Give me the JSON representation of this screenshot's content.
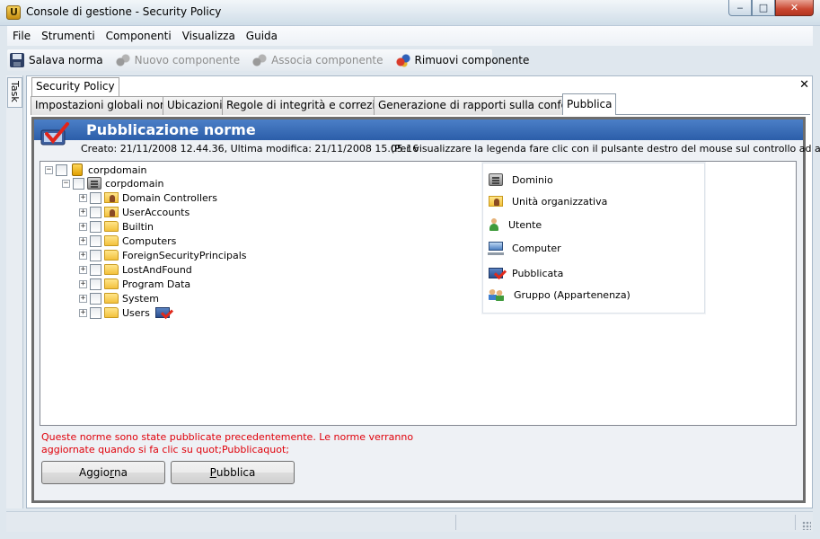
{
  "window": {
    "title": "Console di gestione  - Security Policy",
    "controls": {
      "minimize": "‒",
      "maximize": "□",
      "close": "✕"
    }
  },
  "menu": [
    "File",
    "Strumenti",
    "Componenti",
    "Visualizza",
    "Guida"
  ],
  "toolbar": {
    "save": "Salava norma",
    "new_component": "Nuovo componente",
    "associate": "Associa componente",
    "remove": "Rimuovi componente"
  },
  "task_tab": "Task",
  "document_tab": "Security Policy",
  "close_glyph": "✕",
  "tabs": [
    "Impostazioni globali norme",
    "Ubicazioni",
    "Regole di integrità e correzione",
    "Generazione di rapporti sulla conformità",
    "Pubblica"
  ],
  "active_tab_index": 4,
  "publish": {
    "title": "Pubblicazione norme",
    "created_line": "Creato: 21/11/2008 12.44.36, Ultima modifica: 21/11/2008 15.05.16",
    "legend_hint": "(Per visualizzare la legenda fare clic con il pulsante destro del mouse sul controllo ad albero.)",
    "tree": {
      "root": "corpdomain",
      "domain": "corpdomain",
      "children": [
        {
          "label": "Domain Controllers",
          "icon": "ou-icon"
        },
        {
          "label": "UserAccounts",
          "icon": "ou-icon"
        },
        {
          "label": "Builtin",
          "icon": "folder-icon"
        },
        {
          "label": "Computers",
          "icon": "folder-icon"
        },
        {
          "label": "ForeignSecurityPrincipals",
          "icon": "folder-icon"
        },
        {
          "label": "LostAndFound",
          "icon": "folder-icon"
        },
        {
          "label": "Program Data",
          "icon": "folder-icon"
        },
        {
          "label": "System",
          "icon": "folder-icon"
        },
        {
          "label": "Users",
          "icon": "folder-icon",
          "published": true
        }
      ]
    },
    "legend": [
      {
        "label": "Dominio",
        "icon": "domain-icon"
      },
      {
        "label": "Unità organizzativa",
        "icon": "ou-icon"
      },
      {
        "label": "Utente",
        "icon": "user-icon"
      },
      {
        "label": "Computer",
        "icon": "computer-icon"
      },
      {
        "label": "Pubblicata",
        "icon": "published-icon"
      },
      {
        "label": "Gruppo (Appartenenza)",
        "icon": "group-icon"
      }
    ],
    "warning": "Queste norme sono state pubblicate precedentemente. Le norme verranno aggiornate quando si fa clic su quot;Pubblicaquot;",
    "refresh_button": {
      "before": "Aggio",
      "hotkey": "r",
      "after": "na"
    },
    "publish_button": {
      "before": "",
      "hotkey": "P",
      "after": "ubblica"
    },
    "colors": {
      "banner": "#2c5ea9",
      "warning": "#e0000a"
    }
  }
}
